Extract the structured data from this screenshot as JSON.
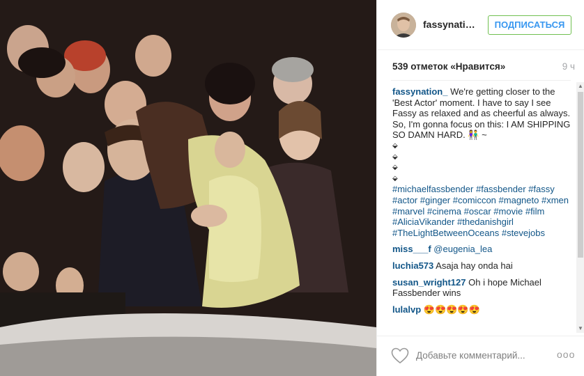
{
  "post": {
    "image_alt": "Photo of a couple embracing in a crowd"
  },
  "header": {
    "username": "fassynatio...",
    "follow_label": "ПОДПИСАТЬСЯ"
  },
  "meta": {
    "likes": "539 отметок «Нравится»",
    "time": "9 ч"
  },
  "caption": {
    "user": "fassynation_",
    "text1": "We're getting closer to the 'Best Actor' moment. I have to say I see Fassy as relaxed and as cheerful as always.",
    "text2": "So, I'm gonna focus on this: I AM SHIPPING SO DAMN HARD. 👫 ~",
    "dots": [
      "⬙",
      "⬙",
      "⬙",
      "⬙"
    ],
    "hashtags": [
      "#michaelfassbender",
      "#fassbender",
      "#fassy",
      "#actor",
      "#ginger",
      "#comiccon",
      "#magneto",
      "#xmen",
      "#marvel",
      "#cinema",
      "#oscar",
      "#movie",
      "#film",
      "#AliciaVikander",
      "#thedanishgirl",
      "#TheLightBetweenOceans",
      "#stevejobs"
    ]
  },
  "comments": [
    {
      "user": "miss___f",
      "text": "@eugenia_lea"
    },
    {
      "user": "luchia573",
      "text": "Asaja hay onda hai"
    },
    {
      "user": "susan_wright127",
      "text": "Oh i hope Michael Fassbender wins"
    },
    {
      "user": "lulalvp",
      "text": "😍😍😍😍😍"
    }
  ],
  "footer": {
    "add_comment_placeholder": "Добавьте комментарий...",
    "more": "ooo"
  },
  "colors": {
    "link": "#125688",
    "follow_text": "#3897f0",
    "follow_border": "#70c050"
  }
}
